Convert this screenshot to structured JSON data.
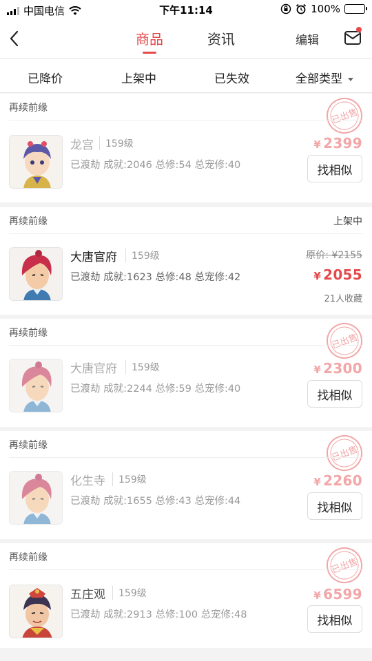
{
  "status_bar": {
    "carrier": "中国电信",
    "time": "下午11:14",
    "battery_percent": "100%",
    "battery_level": 1.0
  },
  "nav": {
    "tabs": [
      {
        "label": "商品",
        "active": true
      },
      {
        "label": "资讯",
        "active": false
      }
    ],
    "edit_label": "编辑",
    "icons": {
      "back": "chevron-left-icon",
      "message": "mail-icon"
    }
  },
  "filters": [
    {
      "label": "已降价"
    },
    {
      "label": "上架中"
    },
    {
      "label": "已失效"
    },
    {
      "label": "全部类型"
    }
  ],
  "colors": {
    "accent": "#e5494b",
    "sold_price": "#f2a6a7",
    "stamp": "#f2a6a7"
  },
  "stamp_text": "已出售",
  "items": [
    {
      "server": "再续前缘",
      "name": "龙宫",
      "level": "159级",
      "stats": "已渡劫 成就:2046 总修:54 总宠修:40",
      "price": "2399",
      "sold": true,
      "button": "找相似"
    },
    {
      "server": "再续前缘",
      "status": "上架中",
      "name": "大唐官府",
      "level": "159级",
      "stats": "已渡劫 成就:1623 总修:48 总宠修:42",
      "original_price": "原价: ¥2155",
      "price": "2055",
      "favorites": "21人收藏",
      "sold": false
    },
    {
      "server": "再续前缘",
      "name": "大唐官府",
      "level": "159级",
      "stats": "已渡劫 成就:2244 总修:59 总宠修:40",
      "price": "2300",
      "sold": true,
      "button": "找相似"
    },
    {
      "server": "再续前缘",
      "name": "化生寺",
      "level": "159级",
      "stats": "已渡劫 成就:1655 总修:43 总宠修:44",
      "price": "2260",
      "sold": true,
      "button": "找相似"
    },
    {
      "server": "再续前缘",
      "name": "五庄观",
      "level": "159级",
      "stats": "已渡劫 成就:2913 总修:100 总宠修:48",
      "price": "6599",
      "sold": true,
      "button": "找相似"
    }
  ],
  "currency_symbol": "¥"
}
